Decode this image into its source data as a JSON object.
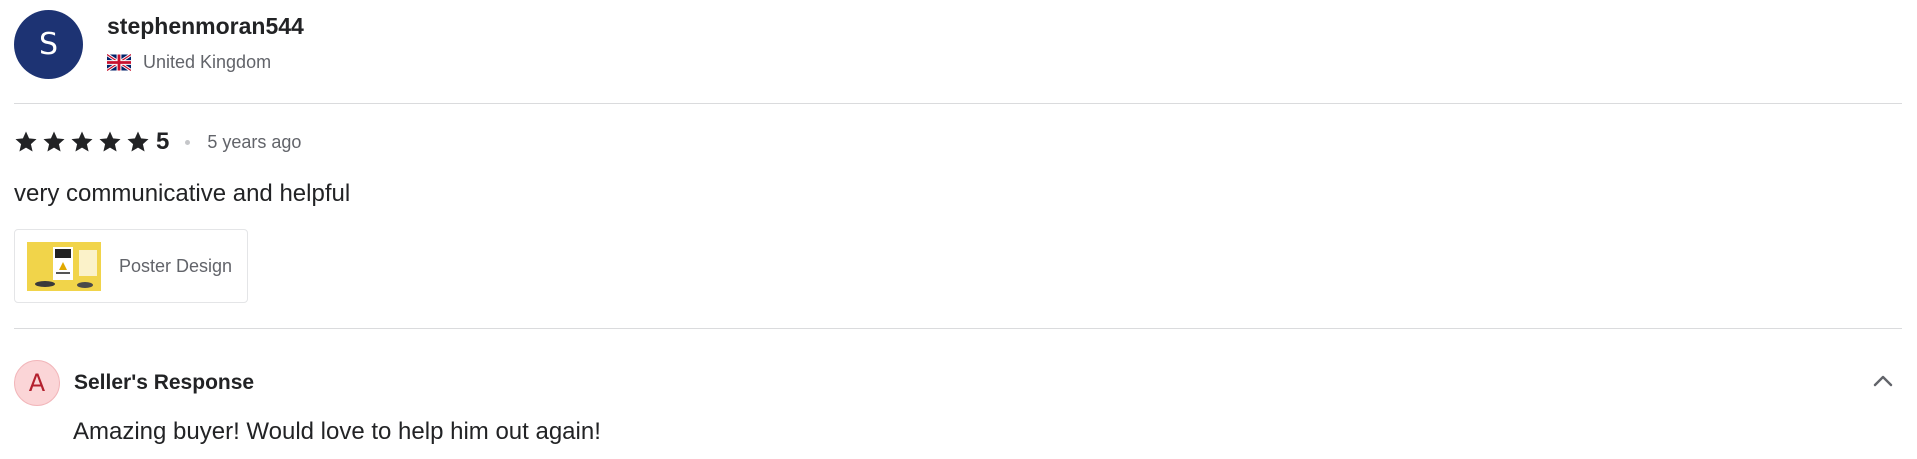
{
  "reviewer": {
    "avatar_initial": "S",
    "username": "stephenmoran544",
    "country": "United Kingdom",
    "flag_icon": "uk-flag-icon"
  },
  "rating": {
    "stars": 5,
    "max_stars": 5,
    "value_label": "5",
    "time_ago": "5 years ago"
  },
  "review": {
    "text": "very communicative and helpful"
  },
  "gig": {
    "title": "Poster Design",
    "thumbnail_color": "#f1d44a"
  },
  "seller_response": {
    "avatar_initial": "A",
    "title": "Seller's Response",
    "text": "Amazing buyer! Would love to help him out again!",
    "collapse_icon": "chevron-up-icon"
  },
  "colors": {
    "avatar_bg": "#1d3373",
    "seller_avatar_bg": "#fbd5d7",
    "seller_avatar_text": "#b4202e",
    "text_primary": "#222325",
    "text_secondary": "#62646a",
    "divider": "#dadbdd"
  }
}
